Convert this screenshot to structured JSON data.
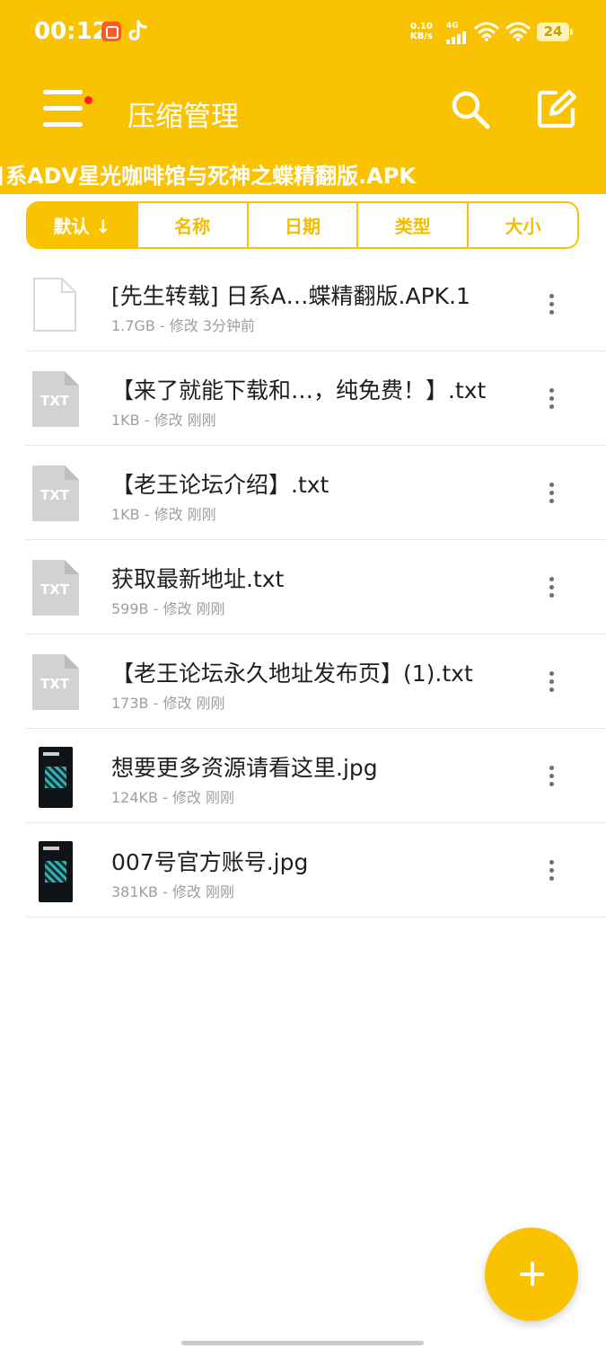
{
  "status_bar": {
    "time": "00:12",
    "net_speed_value": "0.10",
    "net_speed_unit": "KB/s",
    "network_type": "4G",
    "battery": "24"
  },
  "toolbar": {
    "title": "压缩管理",
    "icons": [
      "menu-icon",
      "search-icon",
      "edit-icon"
    ]
  },
  "path": "日系ADV星光咖啡馆与死神之蝶精翻版.APK",
  "sort_tabs": [
    {
      "label": "默认 ↓",
      "active": true
    },
    {
      "label": "名称",
      "active": false
    },
    {
      "label": "日期",
      "active": false
    },
    {
      "label": "类型",
      "active": false
    },
    {
      "label": "大小",
      "active": false
    }
  ],
  "files": [
    {
      "name": "[先生转载] 日系A…蝶精翻版.APK.1",
      "meta": "1.7GB - 修改 3分钟前",
      "icon": "file-icon"
    },
    {
      "name": "【来了就能下载和…，纯免费！】.txt",
      "meta": "1KB - 修改 刚刚",
      "icon": "txt-file-icon",
      "icon_label": "TXT"
    },
    {
      "name": "【老王论坛介绍】.txt",
      "meta": "1KB - 修改 刚刚",
      "icon": "txt-file-icon",
      "icon_label": "TXT"
    },
    {
      "name": "获取最新地址.txt",
      "meta": "599B - 修改 刚刚",
      "icon": "txt-file-icon",
      "icon_label": "TXT"
    },
    {
      "name": "【老王论坛永久地址发布页】(1).txt",
      "meta": "173B - 修改 刚刚",
      "icon": "txt-file-icon",
      "icon_label": "TXT"
    },
    {
      "name": "想要更多资源请看这里.jpg",
      "meta": "124KB - 修改 刚刚",
      "icon": "image-thumbnail"
    },
    {
      "name": "007号官方账号.jpg",
      "meta": "381KB - 修改 刚刚",
      "icon": "image-thumbnail"
    }
  ],
  "colors": {
    "accent": "#f9c301",
    "text_primary": "#1f1f1f",
    "text_secondary": "#9e9e9e"
  }
}
